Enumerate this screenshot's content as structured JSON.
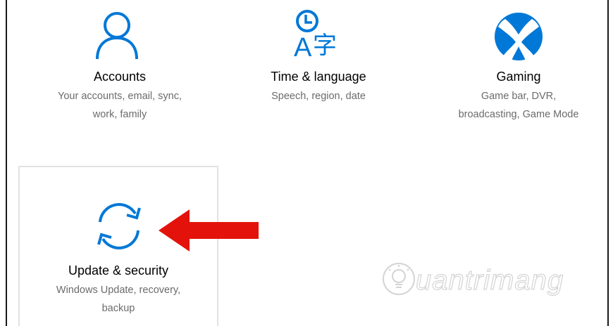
{
  "tiles": [
    {
      "title": "Accounts",
      "desc": [
        "Your accounts, email, sync,",
        "work, family"
      ],
      "icon": "person-icon"
    },
    {
      "title": "Time & language",
      "desc": [
        "Speech, region, date"
      ],
      "icon": "time-language-icon"
    },
    {
      "title": "Gaming",
      "desc": [
        "Game bar, DVR,",
        "broadcasting, Game Mode"
      ],
      "icon": "xbox-icon"
    },
    {
      "title": "Update & security",
      "desc": [
        "Windows Update, recovery,",
        "backup"
      ],
      "icon": "sync-icon"
    }
  ],
  "glyphs": {
    "time_language_latin": "A",
    "time_language_cjk": "字"
  },
  "annotation": {
    "arrow_color": "#e3130b",
    "points_to": "Update & security"
  },
  "watermark": {
    "text": "uantrimang"
  },
  "colors": {
    "accent": "#0078d7",
    "title": "#000000",
    "description": "#6b6b6b",
    "selected_border": "#e2e2e2"
  }
}
